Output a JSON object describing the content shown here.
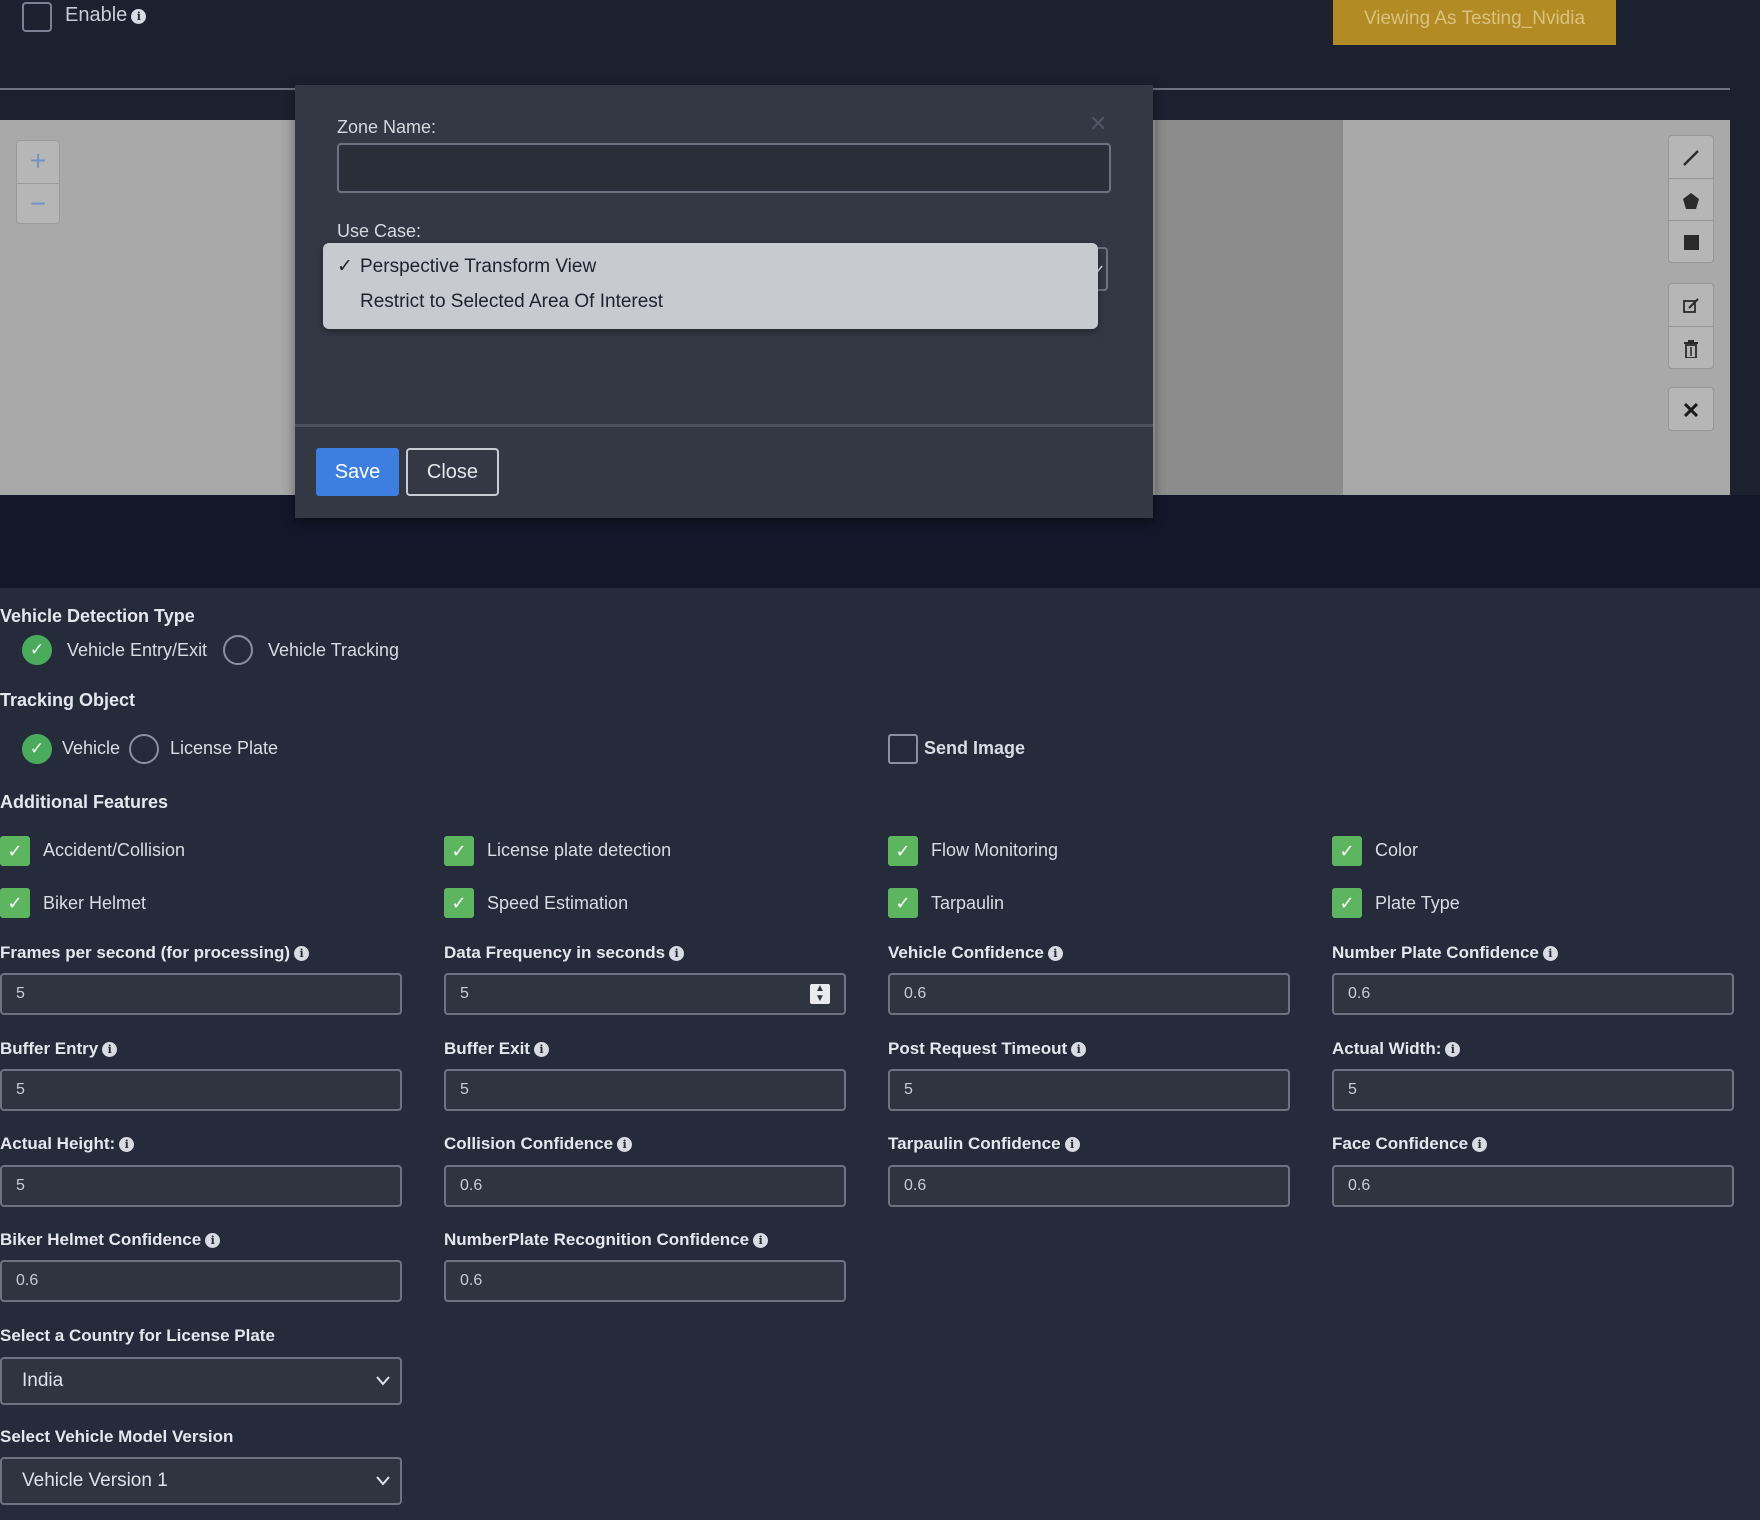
{
  "header": {
    "enable_label": "Enable",
    "viewing_badge": "Viewing As Testing_Nvidia"
  },
  "map": {
    "zoom_in": "+",
    "zoom_out": "−"
  },
  "modal": {
    "zone_name_label": "Zone Name:",
    "zone_name_value": "",
    "use_case_label": "Use Case:",
    "options": [
      {
        "label": "Perspective Transform View",
        "selected": true
      },
      {
        "label": "Restrict to Selected Area Of Interest",
        "selected": false
      }
    ],
    "save_label": "Save",
    "close_label": "Close"
  },
  "detection_type": {
    "title": "Vehicle Detection Type",
    "options": [
      "Vehicle Entry/Exit",
      "Vehicle Tracking"
    ],
    "selected": "Vehicle Entry/Exit"
  },
  "tracking_object": {
    "title": "Tracking Object",
    "options": [
      "Vehicle",
      "License Plate"
    ],
    "selected": "Vehicle",
    "send_image_label": "Send Image",
    "send_image_checked": false
  },
  "additional_features": {
    "title": "Additional Features",
    "items": [
      {
        "label": "Accident/Collision",
        "checked": true
      },
      {
        "label": "License plate detection",
        "checked": true
      },
      {
        "label": "Flow Monitoring",
        "checked": true
      },
      {
        "label": "Color",
        "checked": true
      },
      {
        "label": "Biker Helmet",
        "checked": true
      },
      {
        "label": "Speed Estimation",
        "checked": true
      },
      {
        "label": "Tarpaulin",
        "checked": true
      },
      {
        "label": "Plate Type",
        "checked": true
      }
    ]
  },
  "fields": [
    {
      "label": "Frames per second (for processing)",
      "value": "5"
    },
    {
      "label": "Data Frequency in seconds",
      "value": "5"
    },
    {
      "label": "Vehicle Confidence",
      "value": "0.6"
    },
    {
      "label": "Number Plate Confidence",
      "value": "0.6"
    },
    {
      "label": "Buffer Entry",
      "value": "5"
    },
    {
      "label": "Buffer Exit",
      "value": "5"
    },
    {
      "label": "Post Request Timeout",
      "value": "5"
    },
    {
      "label": "Actual Width:",
      "value": "5"
    },
    {
      "label": "Actual Height:",
      "value": "5"
    },
    {
      "label": "Collision Confidence",
      "value": "0.6"
    },
    {
      "label": "Tarpaulin Confidence",
      "value": "0.6"
    },
    {
      "label": "Face Confidence",
      "value": "0.6"
    },
    {
      "label": "Biker Helmet Confidence",
      "value": "0.6"
    },
    {
      "label": "NumberPlate Recognition Confidence",
      "value": "0.6"
    }
  ],
  "country_select": {
    "label": "Select a Country for License Plate",
    "value": "India"
  },
  "model_select": {
    "label": "Select Vehicle Model Version",
    "value": "Vehicle Version 1"
  },
  "colors": {
    "accent_blue": "#3d7fe0",
    "check_green": "#5db55f",
    "badge_gold": "#b38b25"
  }
}
